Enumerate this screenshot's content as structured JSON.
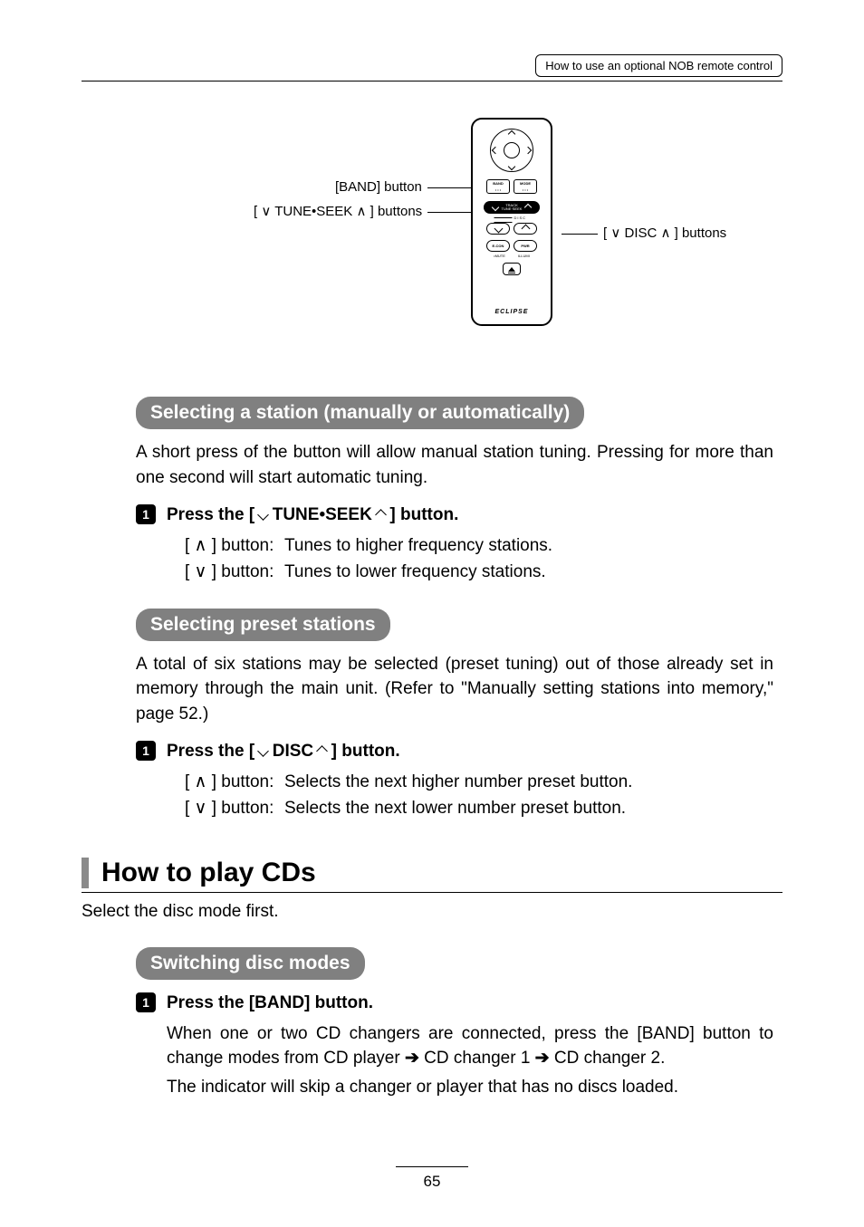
{
  "header": {
    "label": "How to use an optional NOB remote control"
  },
  "diagram": {
    "label_band": "[BAND] button",
    "label_tune": "[ ∨ TUNE•SEEK ∧ ] buttons",
    "label_disc": "[ ∨ DISC ∧ ] buttons",
    "remote": {
      "band": "BAND",
      "mode": "MODE",
      "track_top": "TRACK",
      "track_bottom": "TUNE·SEEK",
      "disc": "DISC",
      "econ": "E-CON",
      "pwr": "PWR",
      "mute": "•MUTE",
      "illumi": "ILLUMI",
      "brand": "ECLIPSE"
    }
  },
  "section1": {
    "heading": "Selecting a station (manually or automatically)",
    "intro": "A short press of the button will allow manual station tuning. Pressing for more than one second will start automatic tuning.",
    "step1": {
      "title_pre": "Press the [ ",
      "title_mid": " TUNE•SEEK ",
      "title_post": " ] button.",
      "up_label": "[ ∧ ] button:",
      "up_text": "Tunes to higher frequency stations.",
      "down_label": "[ ∨ ] button:",
      "down_text": "Tunes to lower frequency stations."
    }
  },
  "section2": {
    "heading": "Selecting preset stations",
    "intro": "A total of six stations may be selected (preset tuning) out of those already set in memory through the main unit. (Refer to \"Manually setting stations into memory,\" page 52.)",
    "step1": {
      "title_pre": "Press the [ ",
      "title_mid": " DISC ",
      "title_post": " ] button.",
      "up_label": "[ ∧ ] button:",
      "up_text": "Selects the next higher number preset button.",
      "down_label": "[ ∨ ] button:",
      "down_text": "Selects the next lower number preset button."
    }
  },
  "main2": {
    "heading": "How to play CDs",
    "intro": "Select the disc mode first."
  },
  "section3": {
    "heading": "Switching disc modes",
    "step1": {
      "title": "Press the [BAND] button.",
      "body1a": "When one or two CD changers are connected, press the [BAND] button to change modes from CD player ",
      "body1b": " CD changer 1 ",
      "body1c": " CD changer 2.",
      "body2": "The indicator will skip a changer or player that has no discs loaded."
    }
  },
  "page": "65"
}
